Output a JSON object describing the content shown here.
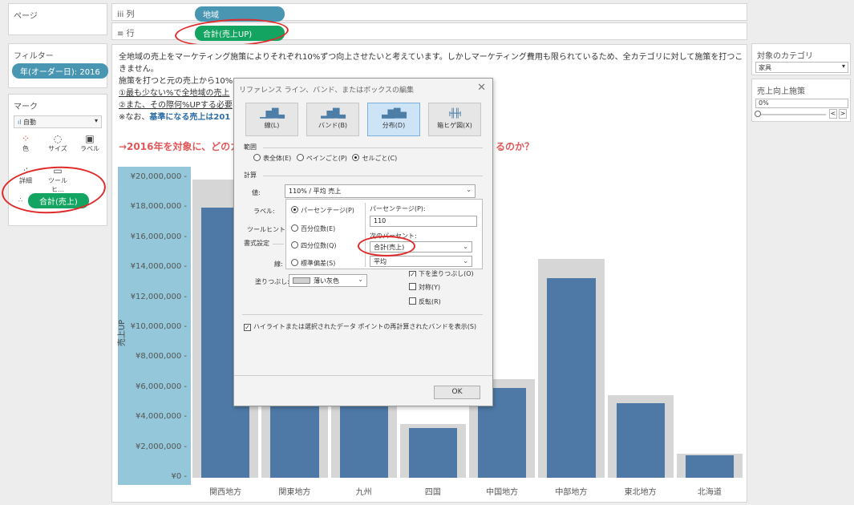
{
  "pages": {
    "label": "ページ"
  },
  "filters": {
    "label": "フィルター",
    "pill": "年(オーダー日): 2016"
  },
  "marks": {
    "label": "マーク",
    "type": "自動",
    "buttons": {
      "color": "色",
      "size": "サイズ",
      "label": "ラベル",
      "detail": "詳細",
      "tooltip": "ツールヒ…"
    },
    "field_pill": "合計(売上)"
  },
  "columns_shelf": {
    "icon": "iii",
    "label": "列",
    "pill": "地域"
  },
  "rows_shelf": {
    "icon": "≡",
    "label": "行",
    "pill": "合計(売上UP)"
  },
  "description": {
    "line1": "全地域の売上をマーケティング施策によりそれぞれ10%ずつ向上させたいと考えています。しかしマーケティング費用も限られているため、全カテゴリに対して施策を打つことがで",
    "line2": "きません。",
    "line3": "施策を打つと元の売上から10%",
    "line4": "①最も少ない%で全地域の売上",
    "line5": "②また、その際何%UPする必要",
    "line6_a": "※なお、",
    "line6_b": "基準になる売上は201",
    "question_a": "→2016年を対象に、どのカテ",
    "question_b": "るのか？"
  },
  "params": {
    "category_label": "対象のカテゴリ",
    "category_value": "家具",
    "uplift_label": "売上向上施策",
    "uplift_value": "0%"
  },
  "chart_data": {
    "type": "bar",
    "categories": [
      "関西地方",
      "関東地方",
      "九州",
      "四国",
      "中国地方",
      "中部地方",
      "東北地方",
      "北海道"
    ],
    "values": [
      18000000,
      10500000,
      7300000,
      3300000,
      6000000,
      13300000,
      5000000,
      1500000
    ],
    "band_values": [
      19900000,
      11600000,
      8000000,
      3600000,
      6600000,
      14600000,
      5500000,
      1600000
    ],
    "ylabel": "売上UP",
    "ylim": [
      0,
      20000000
    ],
    "yticks": [
      "¥0",
      "¥2,000,000",
      "¥4,000,000",
      "¥6,000,000",
      "¥8,000,000",
      "¥10,000,000",
      "¥12,000,000",
      "¥14,000,000",
      "¥16,000,000",
      "¥18,000,000",
      "¥20,000,000"
    ]
  },
  "dialog": {
    "title": "リファレンス ライン、バンド、またはボックスの編集",
    "types": [
      "線(L)",
      "バンド(B)",
      "分布(D)",
      "箱ヒゲ図(X)"
    ],
    "scope_label": "範囲",
    "scope_options": [
      "表全体(E)",
      "ペインごと(P)",
      "セルごと(C)"
    ],
    "calc_label": "計算",
    "value_label": "値:",
    "value": "110% / 平均 売上",
    "label_label": "ラベル:",
    "tooltip_label": "ツールヒント:",
    "format_label": "書式設定",
    "line_label": "線:",
    "fill_label": "塗りつぶし:",
    "fill_value": "薄い灰色",
    "dist_options": [
      "パーセンテージ(P)",
      "百分位数(E)",
      "四分位数(Q)",
      "標準偏差(S)"
    ],
    "percentage_label": "パーセンテージ(P):",
    "percentage_value": "110",
    "of_label": "次のパーセント:",
    "of_value": "合計(売上)",
    "agg_value": "平均",
    "fill_below": "下を塗りつぶし(O)",
    "symmetric": "対称(Y)",
    "reverse": "反転(R)",
    "highlight_option": "ハイライトまたは選択されたデータ ポイントの再計算されたバンドを表示(S)",
    "ok": "OK"
  }
}
